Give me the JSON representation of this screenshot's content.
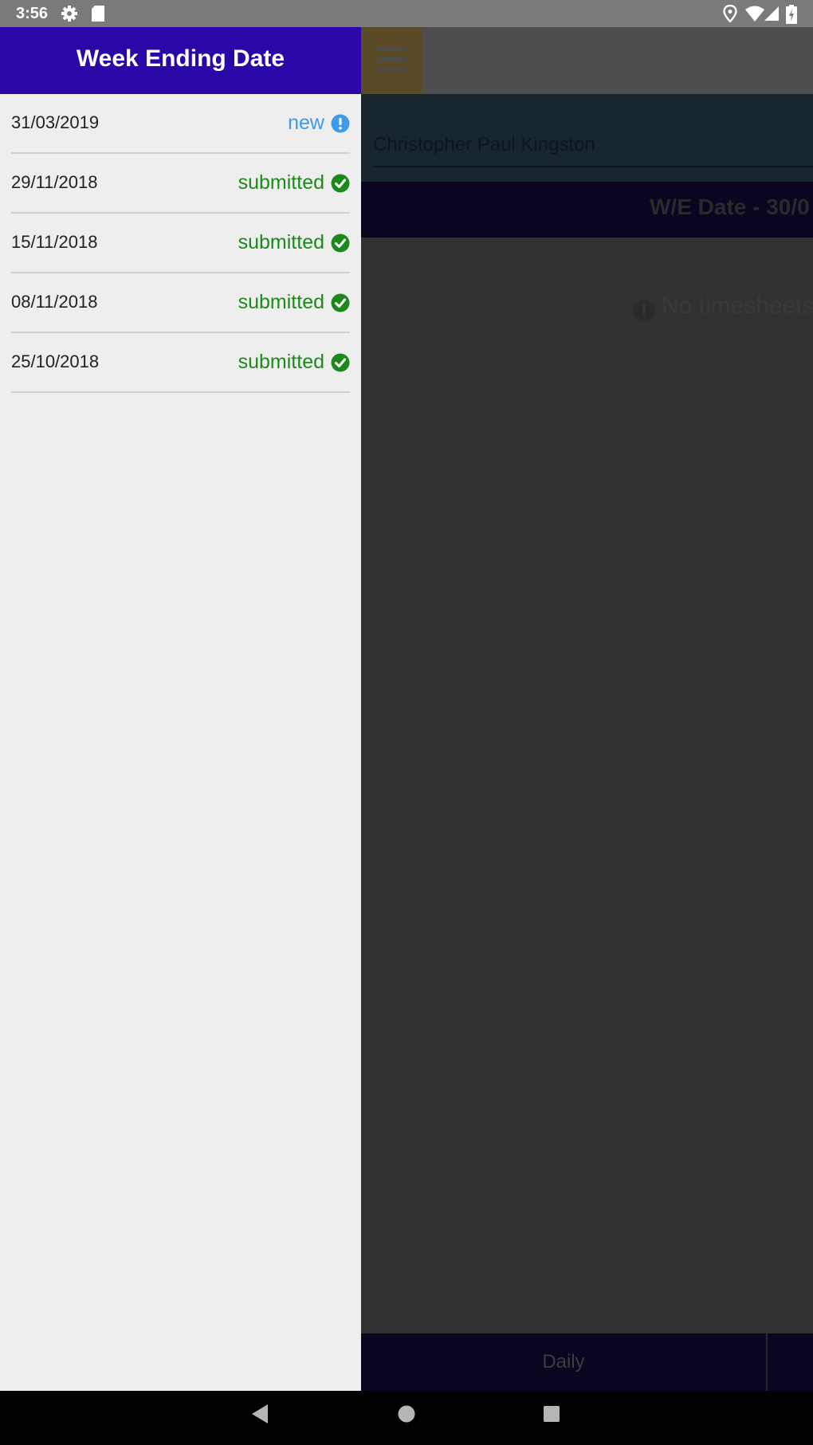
{
  "status_bar": {
    "time": "3:56",
    "icons": [
      "gear-icon",
      "sd-card-icon",
      "location-icon",
      "wifi-icon",
      "signal-icon",
      "battery-charging-icon"
    ]
  },
  "drawer": {
    "title": "Week Ending Date",
    "items": [
      {
        "date": "31/03/2019",
        "status": "new",
        "icon": "info-circle-icon"
      },
      {
        "date": "29/11/2018",
        "status": "submitted",
        "icon": "check-circle-icon"
      },
      {
        "date": "15/11/2018",
        "status": "submitted",
        "icon": "check-circle-icon"
      },
      {
        "date": "08/11/2018",
        "status": "submitted",
        "icon": "check-circle-icon"
      },
      {
        "date": "25/10/2018",
        "status": "submitted",
        "icon": "check-circle-icon"
      }
    ]
  },
  "background": {
    "employee_name": "Christopher Paul Kingston",
    "we_date_label": "W/E Date - 30/0",
    "empty_message": "No timesheets",
    "tab_daily": "Daily"
  },
  "colors": {
    "drawer_header": "#2a08a8",
    "status_new": "#3d9be9",
    "status_submitted": "#1b8a1b"
  },
  "nav_bar": {
    "buttons": [
      "back-icon",
      "home-icon",
      "recents-icon"
    ]
  }
}
